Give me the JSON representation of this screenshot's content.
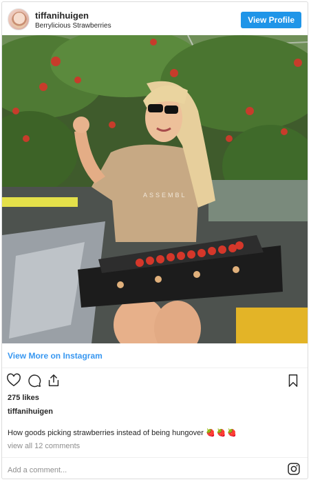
{
  "header": {
    "username": "tiffanihuigen",
    "location": "Berrylicious Strawberries",
    "view_profile_label": "View Profile"
  },
  "photo": {
    "description_icon": "post-photo",
    "shirt_text": "ASSEMBL"
  },
  "link": {
    "view_more_label": "View More on Instagram"
  },
  "actions": {
    "icons": [
      "heart-icon",
      "comment-icon",
      "share-icon",
      "bookmark-icon"
    ]
  },
  "stats": {
    "likes": "275 likes"
  },
  "caption": {
    "username": "tiffanihuigen",
    "text": "How goods picking strawberries instead of being hungover",
    "emoji": "🍓🍓🍓"
  },
  "comments": {
    "view_all_label": "view all 12 comments"
  },
  "footer": {
    "add_comment_placeholder": "Add a comment..."
  },
  "colors": {
    "accent": "#1f95e8",
    "link": "#3897f0",
    "muted": "#8e8e8e"
  }
}
